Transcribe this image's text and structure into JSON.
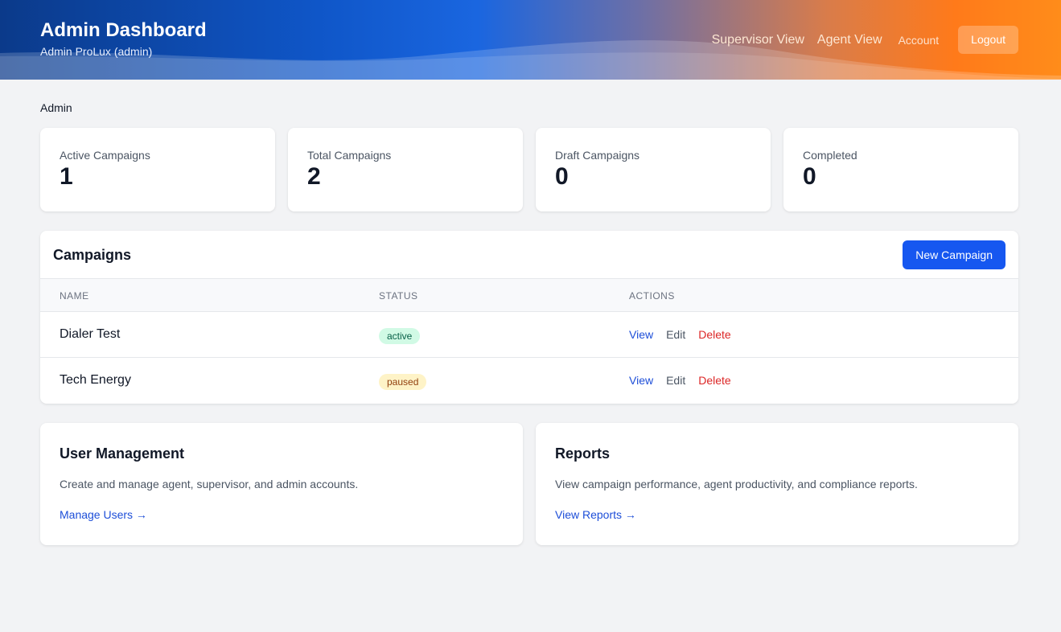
{
  "header": {
    "title": "Admin Dashboard",
    "subtitle": "Admin ProLux (admin)",
    "nav": {
      "supervisor": "Supervisor View",
      "agent": "Agent View",
      "account": "Account",
      "logout": "Logout"
    }
  },
  "breadcrumb": "Admin",
  "stats": [
    {
      "label": "Active Campaigns",
      "value": "1"
    },
    {
      "label": "Total Campaigns",
      "value": "2"
    },
    {
      "label": "Draft Campaigns",
      "value": "0"
    },
    {
      "label": "Completed",
      "value": "0"
    }
  ],
  "campaigns": {
    "title": "Campaigns",
    "new_button": "New Campaign",
    "columns": [
      "NAME",
      "STATUS",
      "ACTIONS"
    ],
    "rows": [
      {
        "name": "Dialer Test",
        "status": "active",
        "view": "View",
        "edit": "Edit",
        "delete": "Delete"
      },
      {
        "name": "Tech Energy",
        "status": "paused",
        "view": "View",
        "edit": "Edit",
        "delete": "Delete"
      }
    ]
  },
  "cards": [
    {
      "title": "User Management",
      "description": "Create and manage agent, supervisor, and admin accounts.",
      "link": "Manage Users →"
    },
    {
      "title": "Reports",
      "description": "View campaign performance, agent productivity, and compliance reports.",
      "link": "View Reports →"
    }
  ],
  "colors": {
    "primary": "#1657f0",
    "header_start": "#0b3a8a",
    "header_end": "#ff8c1a",
    "status_active_bg": "#d1fae5",
    "status_paused_bg": "#fef3c7",
    "delete": "#dc2626"
  }
}
